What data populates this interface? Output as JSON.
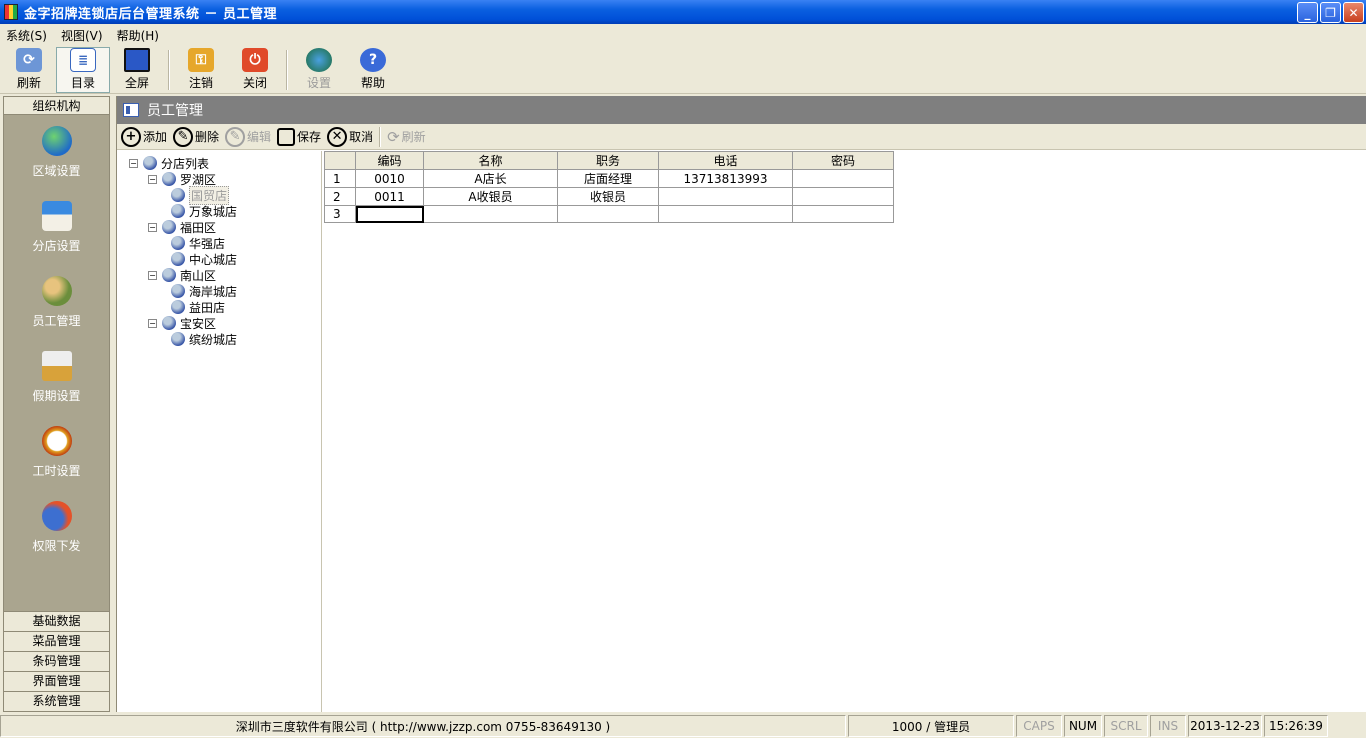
{
  "window": {
    "title": "金字招牌连锁店后台管理系统 － 员工管理",
    "minimize_label": "_",
    "maximize_label": "❐",
    "close_label": "✕"
  },
  "menu": [
    "系统(S)",
    "视图(V)",
    "帮助(H)"
  ],
  "toolbar": {
    "refresh": "刷新",
    "catalog": "目录",
    "fullscreen": "全屏",
    "logout": "注销",
    "close": "关闭",
    "settings": "设置",
    "help": "帮助"
  },
  "leftnav": {
    "header": "组织机构",
    "items": [
      "区域设置",
      "分店设置",
      "员工管理",
      "假期设置",
      "工时设置",
      "权限下发"
    ],
    "bottom": [
      "基础数据",
      "菜品管理",
      "条码管理",
      "界面管理",
      "系统管理"
    ]
  },
  "panel": {
    "title": "员工管理",
    "actions": {
      "add": "添加",
      "delete": "删除",
      "edit": "编辑",
      "save": "保存",
      "cancel": "取消",
      "refresh": "刷新"
    }
  },
  "tree": {
    "root": "分店列表",
    "regions": [
      {
        "name": "罗湖区",
        "stores": [
          "国贸店",
          "万象城店"
        ]
      },
      {
        "name": "福田区",
        "stores": [
          "华强店",
          "中心城店"
        ]
      },
      {
        "name": "南山区",
        "stores": [
          "海岸城店",
          "益田店"
        ]
      },
      {
        "name": "宝安区",
        "stores": [
          "缤纷城店"
        ]
      }
    ],
    "selected": "国贸店"
  },
  "grid": {
    "columns": [
      "编码",
      "名称",
      "职务",
      "电话",
      "密码"
    ],
    "rows": [
      {
        "n": "1",
        "code": "0010",
        "name": "A店长",
        "title": "店面经理",
        "phone": "13713813993",
        "pwd": ""
      },
      {
        "n": "2",
        "code": "0011",
        "name": "A收银员",
        "title": "收银员",
        "phone": "",
        "pwd": ""
      },
      {
        "n": "3",
        "code": "",
        "name": "",
        "title": "",
        "phone": "",
        "pwd": ""
      }
    ]
  },
  "status": {
    "company": "深圳市三度软件有限公司 ( http://www.jzzp.com  0755-83649130 )",
    "user": "1000 / 管理员",
    "caps": "CAPS",
    "num": "NUM",
    "scrl": "SCRL",
    "ins": "INS",
    "date": "2013-12-23",
    "time": "15:26:39"
  },
  "colors": {
    "titlebar": "#0a5fe0",
    "nav_bg": "#aaa58f",
    "panel_head": "#7f7f7f"
  }
}
